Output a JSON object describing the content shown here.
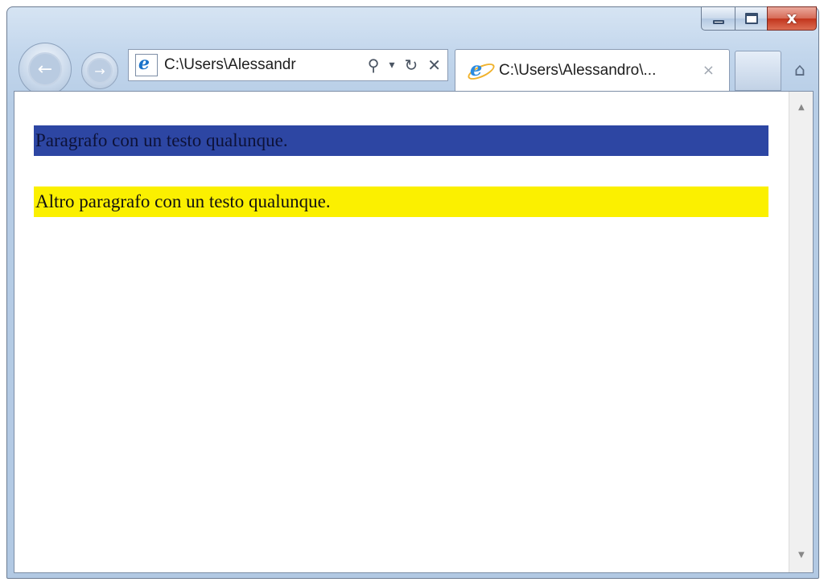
{
  "window": {
    "caption_buttons": {
      "minimize": "minimize",
      "maximize": "maximize",
      "close": "x"
    }
  },
  "toolbar": {
    "back_icon": "arrow-left-icon",
    "forward_icon": "arrow-right-icon",
    "address": "C:\\Users\\Alessandr",
    "search_icon": "⚲",
    "dropdown_icon": "▾",
    "refresh_icon": "↻",
    "stop_icon": "✕"
  },
  "tab": {
    "title": "C:\\Users\\Alessandro\\...",
    "close": "×"
  },
  "content": {
    "paragraphs": [
      {
        "text": "Paragrafo con un testo qualunque.",
        "background": "#2d46a3"
      },
      {
        "text": "Altro paragrafo con un testo qualunque.",
        "background": "#fbf000"
      }
    ]
  },
  "colors": {
    "chrome": "#c2d6ec",
    "close_button": "#c2341c"
  }
}
